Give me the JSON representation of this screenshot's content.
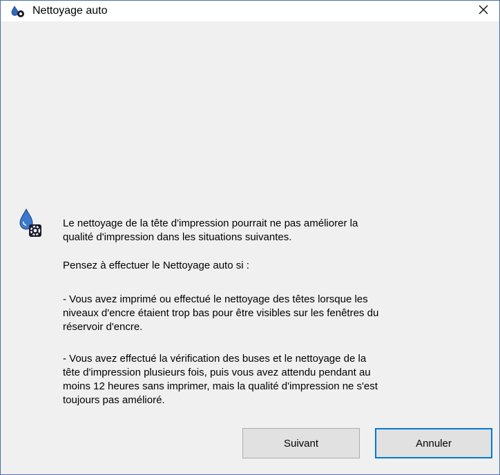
{
  "window": {
    "title": "Nettoyage auto",
    "title_icon": "ink-drop-gear-icon",
    "close_glyph": "close-icon"
  },
  "content": {
    "info_icon": "ink-drop-gear-icon",
    "paragraph_1": "Le nettoyage de la tête d'impression pourrait ne pas améliorer la\nqualité d'impression dans les situations suivantes.",
    "paragraph_2": "Pensez à effectuer le Nettoyage auto si :",
    "paragraph_3": "- Vous avez imprimé ou effectué le nettoyage des têtes lorsque les\nniveaux d'encre étaient trop bas pour être visibles sur les fenêtres du\nréservoir d'encre.",
    "paragraph_4": "- Vous avez effectué la vérification des buses et le nettoyage de la\ntête d'impression plusieurs fois, puis vous avez attendu pendant au\nmoins 12 heures sans imprimer, mais la qualité d'impression ne s'est\ntoujours pas amélioré."
  },
  "buttons": {
    "next_label": "Suivant",
    "cancel_label": "Annuler"
  },
  "colors": {
    "accent": "#0078d7",
    "window_border": "#4a6ea9",
    "dialog_bg": "#f0f0f0"
  }
}
